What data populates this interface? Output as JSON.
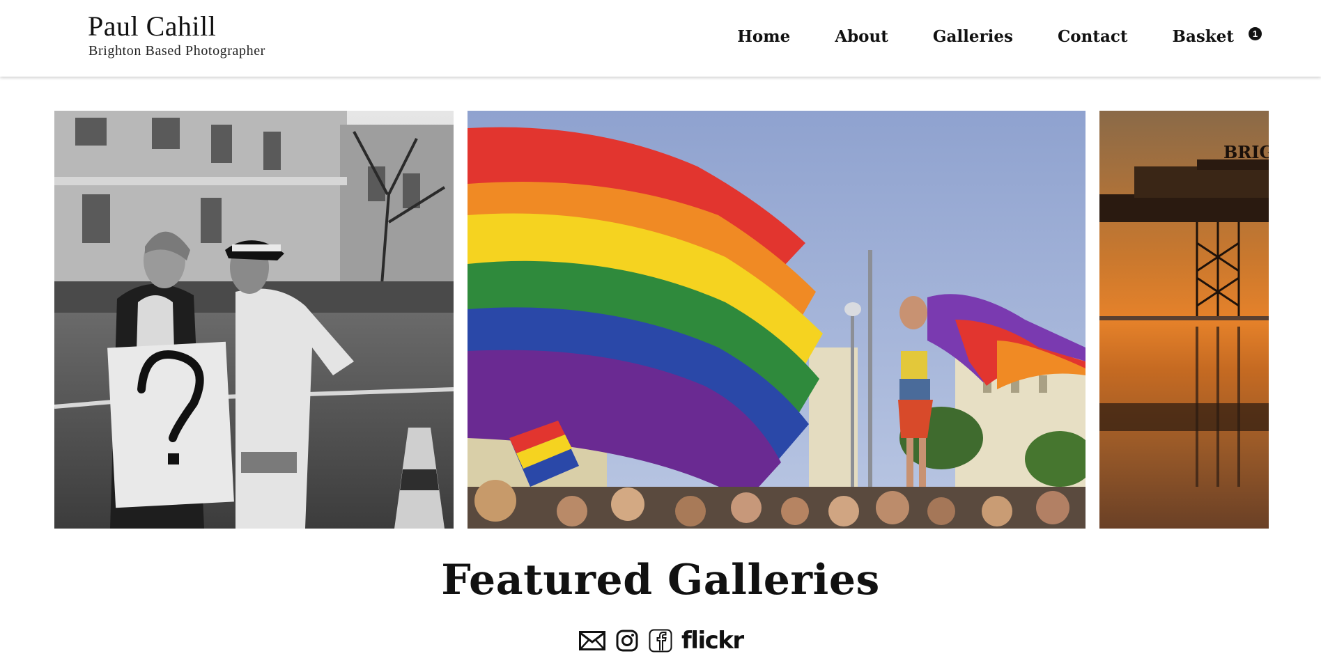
{
  "header": {
    "brand_name": "Paul Cahill",
    "brand_tagline": "Brighton Based Photographer"
  },
  "nav": {
    "items": [
      {
        "label": "Home"
      },
      {
        "label": "About"
      },
      {
        "label": "Galleries"
      },
      {
        "label": "Contact"
      },
      {
        "label": "Basket"
      }
    ],
    "basket_count": "1"
  },
  "carousel": {
    "slides": [
      {
        "subject": "black-and-white protest photo with man holding question-mark sign and police officer"
      },
      {
        "subject": "pride parade with large rainbow flag and dancer waving flag"
      },
      {
        "subject": "Brighton pier silhouette at sunset",
        "sign_text": "BRIG"
      }
    ]
  },
  "featured": {
    "title": "Featured Galleries"
  },
  "socials": {
    "icons": [
      "mail-icon",
      "instagram-icon",
      "facebook-icon",
      "flickr-logo"
    ],
    "flickr_label": "flickr"
  },
  "colors": {
    "background": "#ffffff",
    "text": "#111111",
    "sky_blue": "#9fb0d6",
    "sunset_orange": "#e07a2a"
  }
}
